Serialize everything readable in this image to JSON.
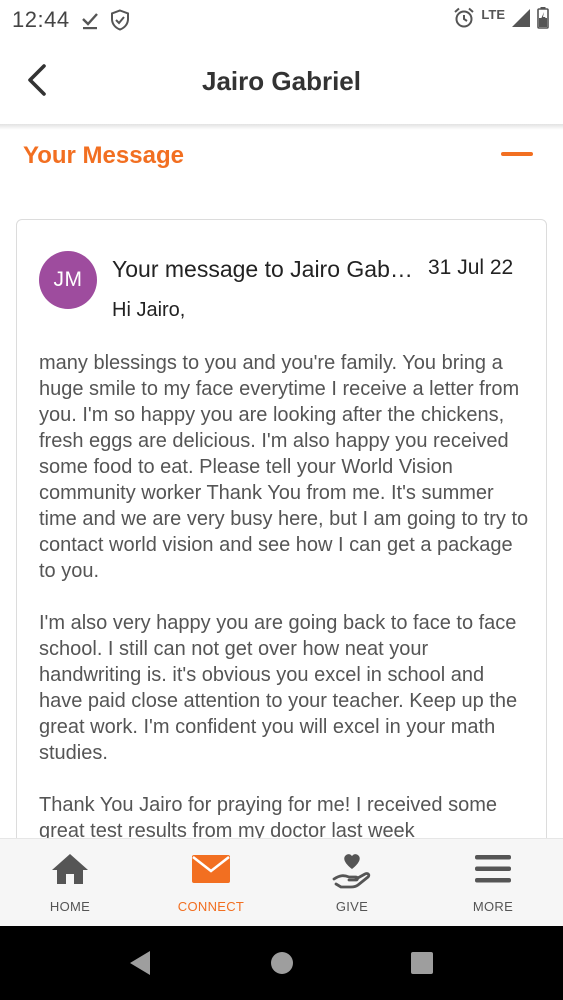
{
  "status_bar": {
    "time": "12:44",
    "network": "LTE",
    "icons": [
      "download-done-icon",
      "shield-icon",
      "alarm-icon",
      "signal-icon",
      "battery-charging-icon"
    ]
  },
  "header": {
    "title": "Jairo Gabriel",
    "back_icon": "back-arrow-icon"
  },
  "section": {
    "title": "Your Message",
    "collapse_icon": "minus-icon"
  },
  "message": {
    "avatar_initials": "JM",
    "avatar_color": "#9e4c9e",
    "subject": "Your message to Jairo Gab…",
    "date": "31 Jul 22",
    "greeting": "Hi Jairo,",
    "paragraphs": [
      "many blessings to you and you're family. You bring a huge smile to my face everytime I receive a letter from you. I'm so happy you are looking after the chickens, fresh eggs are delicious. I'm also happy you received some food to eat. Please tell your World Vision community worker Thank You from me. It's summer time and we are very busy here, but I am going to try to contact world vision and see how I can get a package to you.",
      "I'm also very happy you are going back to face to face school. I still can not get over how neat your handwriting is. it's obvious you excel in school and have paid close attention to your teacher. Keep up the great work. I'm confident you will excel in your math studies.",
      "Thank You Jairo for praying for me! I received some great test results from my doctor last week"
    ]
  },
  "bottom_nav": {
    "items": [
      {
        "label": "HOME",
        "icon": "home-icon",
        "active": false
      },
      {
        "label": "CONNECT",
        "icon": "envelope-icon",
        "active": true
      },
      {
        "label": "GIVE",
        "icon": "hand-heart-icon",
        "active": false
      },
      {
        "label": "MORE",
        "icon": "menu-icon",
        "active": false
      }
    ]
  },
  "colors": {
    "accent": "#f26f21",
    "avatar": "#9e4c9e",
    "nav_inactive": "#555555"
  }
}
